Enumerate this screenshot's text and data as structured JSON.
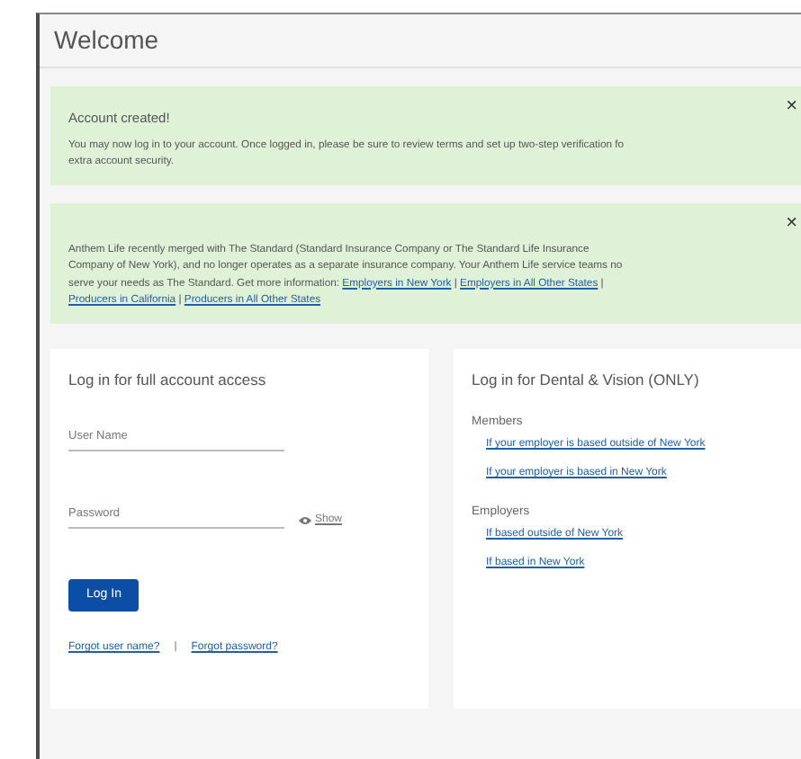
{
  "page": {
    "title": "Welcome"
  },
  "alerts": [
    {
      "title": "Account created!",
      "lines": [
        "You may now log in to your account. Once logged in, please be sure to review terms and set up two-step verification fo",
        "extra account security."
      ],
      "close": "×"
    },
    {
      "lines": [
        "Anthem Life recently merged with The Standard (Standard Insurance Company or The Standard Life Insurance",
        "Company of New York), and no longer operates as a separate insurance company. Your Anthem Life service teams no",
        "serve your needs as The Standard. Get more information:"
      ],
      "close": "×",
      "separator": "|",
      "links": [
        "Employers in New York",
        "Employers in All Other States",
        "Producers in California",
        "Producers in All Other States"
      ]
    }
  ],
  "login": {
    "heading": "Log in for full account access",
    "fields": [
      {
        "placeholder": "User Name"
      },
      {
        "placeholder": "Password",
        "show": "Show"
      }
    ],
    "button": "Log In",
    "links": [
      "Forgot user name?",
      "Forgot password?"
    ],
    "separator": "|"
  },
  "dental": {
    "heading": "Log in for Dental & Vision (ONLY)",
    "groups": [
      {
        "label": "Members",
        "links": [
          "If your employer is based outside of New York",
          "If your employer is based in New York"
        ]
      },
      {
        "label": "Employers",
        "links": [
          "If based outside of New York",
          "If based in New York"
        ]
      }
    ]
  }
}
